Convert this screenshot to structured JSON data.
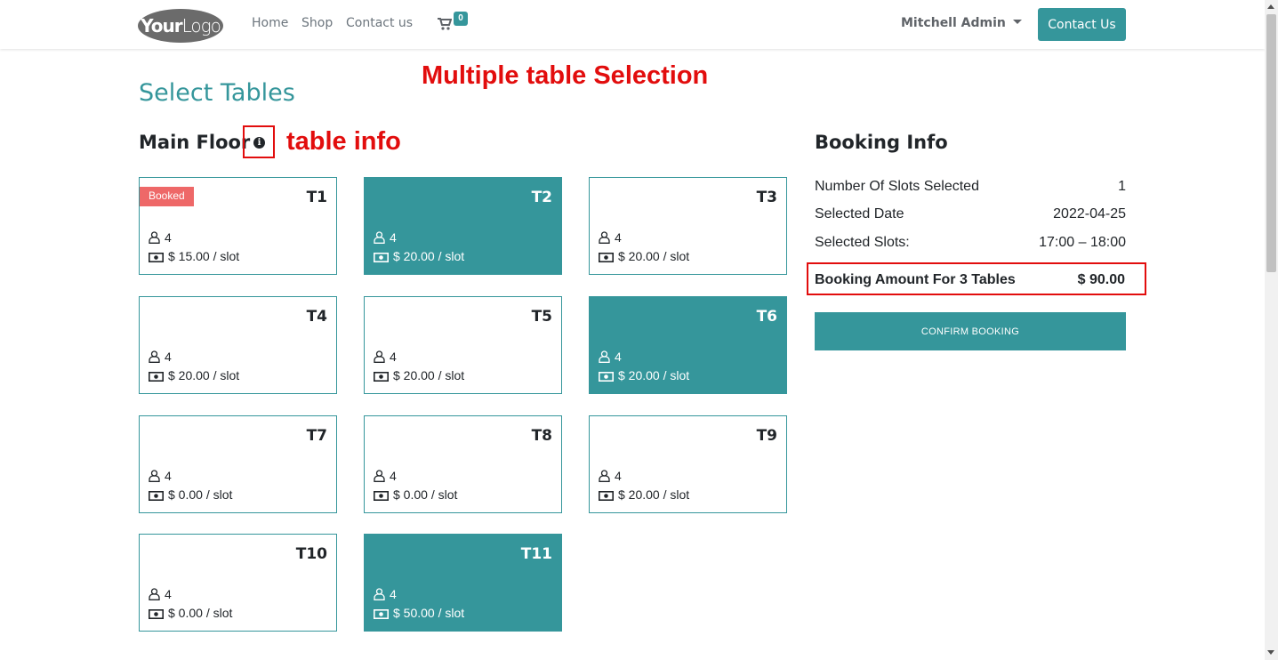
{
  "navbar": {
    "logo_bold": "Your",
    "logo_light": "Logo",
    "links": [
      "Home",
      "Shop",
      "Contact us"
    ],
    "cart_count": "0",
    "user_name": "Mitchell Admin",
    "contact_button": "Contact Us"
  },
  "annotations": {
    "multiple_selection": "Multiple table Selection",
    "table_info": "table info"
  },
  "page_title": "Select Tables",
  "floor": {
    "name": "Main Floor",
    "info_icon": "info-circle-icon"
  },
  "tables": [
    {
      "name": "T1",
      "capacity": "4",
      "price": "$ 15.00 / slot",
      "badge": "Booked",
      "selected": false
    },
    {
      "name": "T2",
      "capacity": "4",
      "price": "$ 20.00 / slot",
      "selected": true
    },
    {
      "name": "T3",
      "capacity": "4",
      "price": "$ 20.00 / slot",
      "selected": false
    },
    {
      "name": "T4",
      "capacity": "4",
      "price": "$ 20.00 / slot",
      "selected": false
    },
    {
      "name": "T5",
      "capacity": "4",
      "price": "$ 20.00 / slot",
      "selected": false
    },
    {
      "name": "T6",
      "capacity": "4",
      "price": "$ 20.00 / slot",
      "selected": true
    },
    {
      "name": "T7",
      "capacity": "4",
      "price": "$ 0.00 / slot",
      "selected": false
    },
    {
      "name": "T8",
      "capacity": "4",
      "price": "$ 0.00 / slot",
      "selected": false
    },
    {
      "name": "T9",
      "capacity": "4",
      "price": "$ 20.00 / slot",
      "selected": false
    },
    {
      "name": "T10",
      "capacity": "4",
      "price": "$ 0.00 / slot",
      "selected": false
    },
    {
      "name": "T11",
      "capacity": "4",
      "price": "$ 50.00 / slot",
      "selected": true
    }
  ],
  "booking": {
    "title": "Booking Info",
    "rows": [
      {
        "label": "Number Of Slots Selected",
        "value": "1"
      },
      {
        "label": "Selected Date",
        "value": "2022-04-25"
      },
      {
        "label": "Selected Slots:",
        "value": "17:00 – 18:00"
      }
    ],
    "amount_label": "Booking Amount For 3 Tables",
    "amount_value": "$ 90.00",
    "confirm_button": "CONFIRM BOOKING"
  },
  "colors": {
    "accent": "#35969b",
    "annotation": "#e20d0d",
    "booked_badge": "#ee6868"
  }
}
